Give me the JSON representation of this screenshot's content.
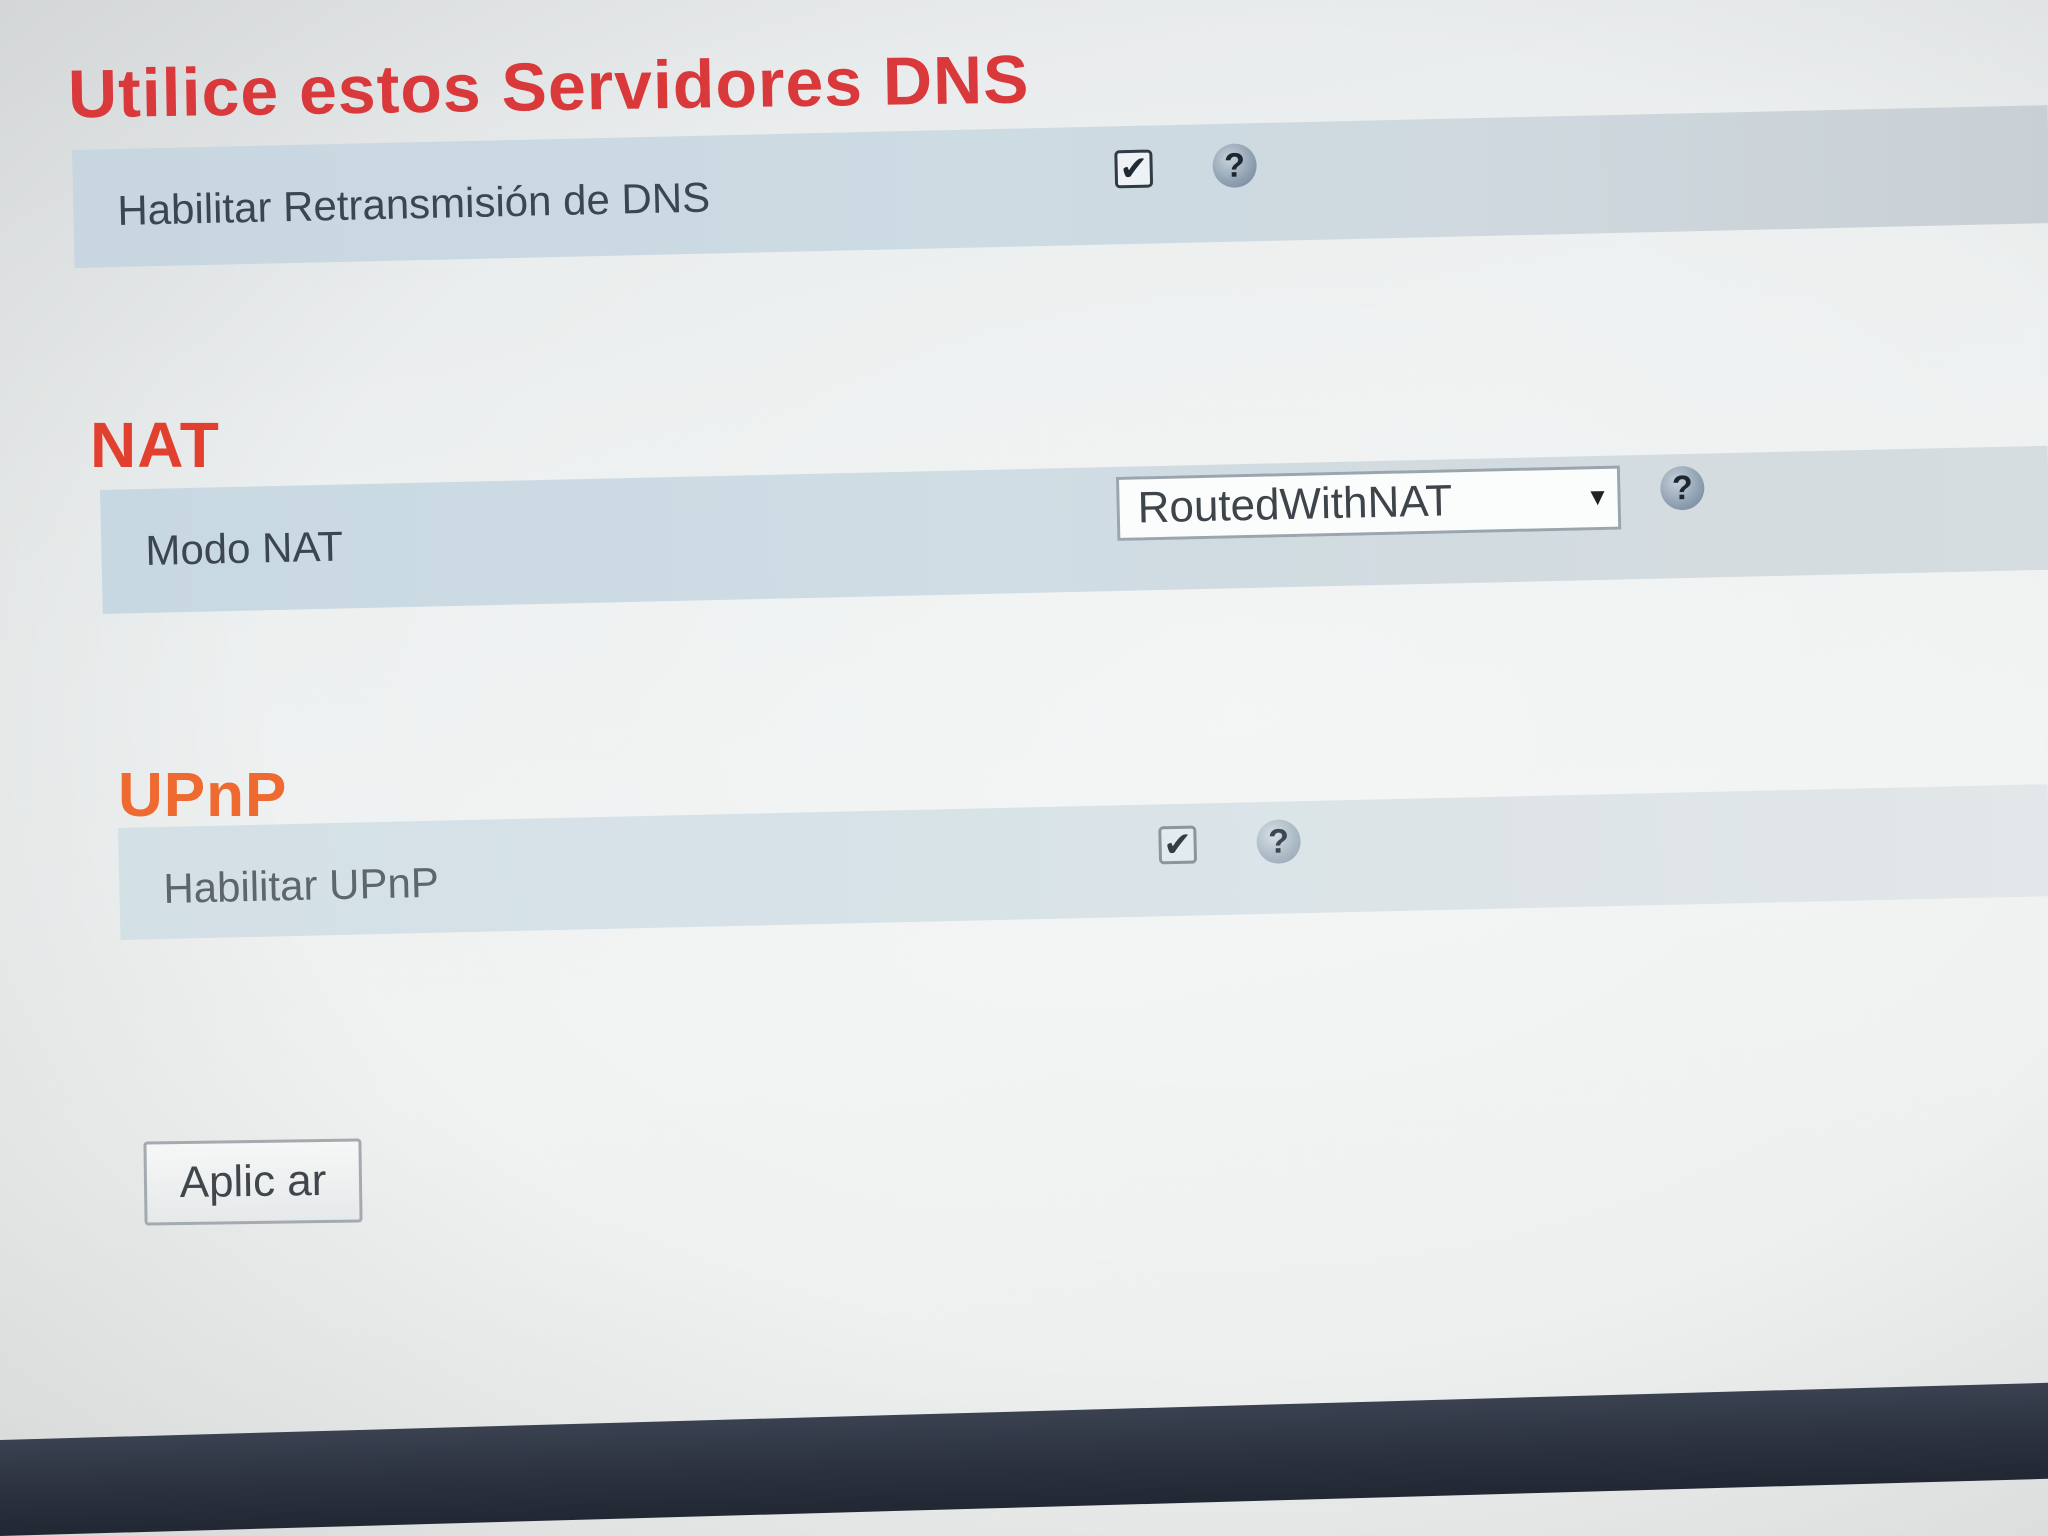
{
  "dns_section": {
    "title": "Utilice estos Servidores DNS",
    "relay_label": "Habilitar Retransmisión de DNS",
    "relay_checked": true,
    "help_glyph": "?",
    "check_glyph": "✔"
  },
  "nat_section": {
    "title": "NAT",
    "mode_label": "Modo NAT",
    "mode_value": "RoutedWithNAT",
    "dropdown_arrow": "▼",
    "help_glyph": "?"
  },
  "upnp_section": {
    "title": "UPnP",
    "enable_label": "Habilitar UPnP",
    "enable_checked": true,
    "help_glyph": "?",
    "check_glyph": "✔"
  },
  "actions": {
    "apply_label": "Aplic ar"
  },
  "colors": {
    "dns_title": "#d9393a",
    "nat_title": "#e2402e",
    "upnp_title": "#ee6a31",
    "row_background": "#cddbe3"
  },
  "icons": {
    "help": "help-icon",
    "checkbox": "checkbox-checked-icon",
    "dropdown": "chevron-down-icon"
  }
}
